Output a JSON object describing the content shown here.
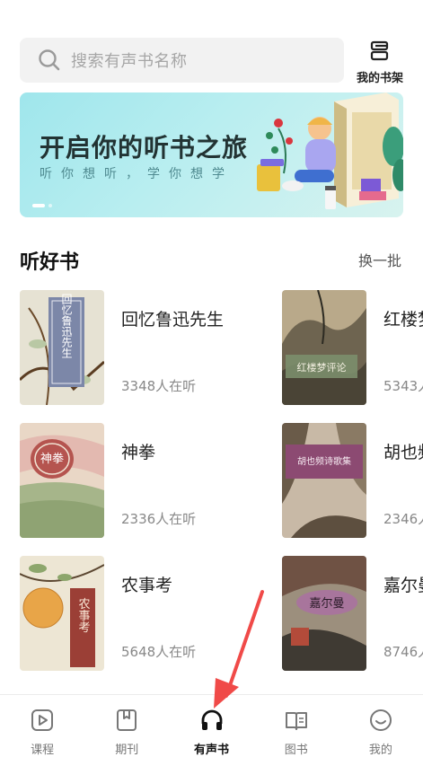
{
  "search": {
    "placeholder": "搜索有声书名称",
    "icon": "search-icon"
  },
  "shelf": {
    "label": "我的书架",
    "icon": "bookshelf-icon"
  },
  "banner": {
    "title": "开启你的听书之旅",
    "subtitle": "听你想听，学你想学"
  },
  "section": {
    "title": "听好书",
    "more_label": "换一批"
  },
  "books": [
    {
      "title": "回忆鲁迅先生",
      "listeners": "3348人在听",
      "cover_text": "回忆鲁迅先生"
    },
    {
      "title": "红楼梦",
      "listeners": "5343人",
      "cover_text": "红楼梦评论"
    },
    {
      "title": "神拳",
      "listeners": "2336人在听",
      "cover_text": "神拳"
    },
    {
      "title": "胡也频",
      "listeners": "2346人",
      "cover_text": "胡也频诗歌集"
    },
    {
      "title": "农事考",
      "listeners": "5648人在听",
      "cover_text": "农事考"
    },
    {
      "title": "嘉尔曼",
      "listeners": "8746人",
      "cover_text": "嘉尔曼"
    }
  ],
  "nav": [
    {
      "label": "课程",
      "icon": "play-course-icon",
      "active": false
    },
    {
      "label": "期刊",
      "icon": "bookmark-journal-icon",
      "active": false
    },
    {
      "label": "有声书",
      "icon": "headphones-icon",
      "active": true
    },
    {
      "label": "图书",
      "icon": "open-book-icon",
      "active": false
    },
    {
      "label": "我的",
      "icon": "smiley-profile-icon",
      "active": false
    }
  ],
  "colors": {
    "accent_arrow": "#f04a48",
    "banner_bg": "#b9eef0",
    "text_primary": "#222222",
    "text_secondary": "#888888"
  }
}
